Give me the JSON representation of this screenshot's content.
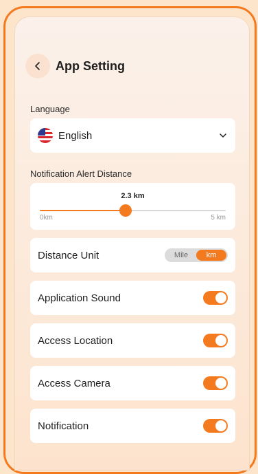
{
  "header": {
    "title": "App Setting",
    "back_icon": "chevron-left-icon"
  },
  "language": {
    "label": "Language",
    "value": "English",
    "flag_icon": "us-flag-icon",
    "dropdown_icon": "chevron-down-icon"
  },
  "alert_distance": {
    "label": "Notification Alert Distance",
    "value_text": "2.3 km",
    "value": 2.3,
    "min": 0,
    "max": 5,
    "min_label": "0km",
    "max_label": "5 km"
  },
  "distance_unit": {
    "label": "Distance Unit",
    "options": [
      "Mile",
      "km"
    ],
    "selected": "km"
  },
  "toggles": [
    {
      "label": "Application Sound",
      "on": true
    },
    {
      "label": "Access Location",
      "on": true
    },
    {
      "label": "Access Camera",
      "on": true
    },
    {
      "label": "Notification",
      "on": true
    }
  ],
  "colors": {
    "accent": "#f47a1f",
    "background": "#fde5cc",
    "card": "#ffffff"
  }
}
